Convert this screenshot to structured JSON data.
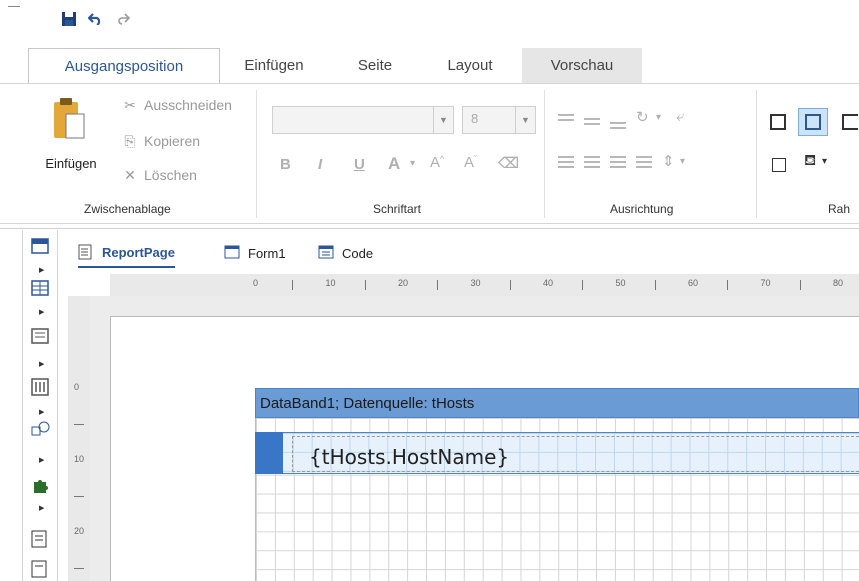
{
  "quick_access": {
    "save": "save-icon",
    "undo": "undo-icon",
    "redo": "redo-icon"
  },
  "tabs": [
    {
      "label": "Ausgangsposition",
      "active": true
    },
    {
      "label": "Einfügen"
    },
    {
      "label": "Seite"
    },
    {
      "label": "Layout"
    },
    {
      "label": "Vorschau"
    }
  ],
  "ribbon": {
    "clipboard": {
      "paste_label": "Einfügen",
      "cut_label": "Ausschneiden",
      "copy_label": "Kopieren",
      "delete_label": "Löschen",
      "group_label": "Zwischenablage"
    },
    "font": {
      "family_value": "",
      "size_value": "8",
      "bold": "B",
      "italic": "I",
      "underline": "U",
      "color": "A",
      "group_label": "Schriftart"
    },
    "alignment": {
      "group_label": "Ausrichtung"
    },
    "border": {
      "group_label": "Rah"
    }
  },
  "document_tabs": [
    {
      "label": "ReportPage",
      "active": true
    },
    {
      "label": "Form1"
    },
    {
      "label": "Code"
    }
  ],
  "ruler": {
    "top_numbers": [
      "0",
      "10",
      "20",
      "30",
      "40",
      "50",
      "60",
      "70",
      "80"
    ],
    "left_numbers": [
      "0",
      "10",
      "20"
    ]
  },
  "band": {
    "header": "DataBand1; Datenquelle: tHosts",
    "field": "{tHosts.HostName}"
  },
  "colors": {
    "accent": "#2b5797",
    "band_header": "#6a9bd4",
    "band_marker": "#3a76c8"
  }
}
